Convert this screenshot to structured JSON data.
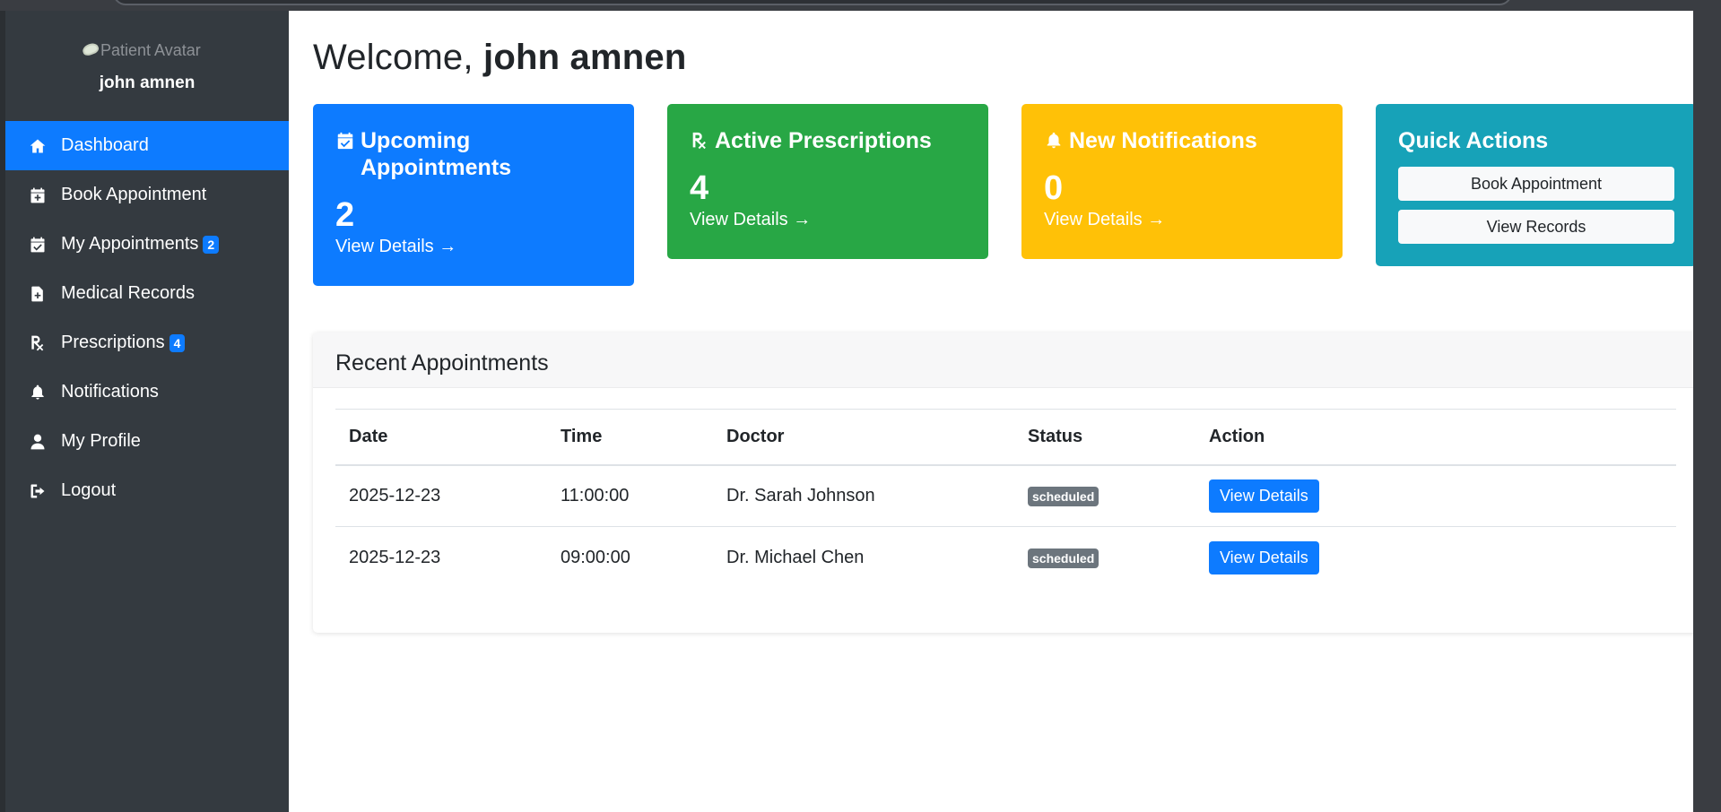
{
  "user": {
    "avatar_alt": "Patient Avatar",
    "name": "john amnen"
  },
  "sidebar": {
    "items": [
      {
        "label": "Dashboard",
        "icon": "home-icon",
        "active": true,
        "badge": ""
      },
      {
        "label": "Book Appointment",
        "icon": "calendar-plus-icon",
        "active": false,
        "badge": ""
      },
      {
        "label": "My Appointments",
        "icon": "calendar-check-icon",
        "active": false,
        "badge": "2"
      },
      {
        "label": "Medical Records",
        "icon": "file-medical-icon",
        "active": false,
        "badge": ""
      },
      {
        "label": "Prescriptions",
        "icon": "prescription-icon",
        "active": false,
        "badge": "4"
      },
      {
        "label": "Notifications",
        "icon": "bell-icon",
        "active": false,
        "badge": ""
      },
      {
        "label": "My Profile",
        "icon": "user-icon",
        "active": false,
        "badge": ""
      },
      {
        "label": "Logout",
        "icon": "sign-out-icon",
        "active": false,
        "badge": ""
      }
    ]
  },
  "main": {
    "welcome_prefix": "Welcome, ",
    "welcome_name": "john amnen",
    "cards": {
      "upcoming": {
        "title": "Upcoming Appointments",
        "value": "2",
        "link": "View Details →",
        "color": "#0d7bff"
      },
      "prescriptions": {
        "title": "Active Prescriptions",
        "value": "4",
        "link": "View Details →",
        "color": "#28a745"
      },
      "notifications": {
        "title": "New Notifications",
        "value": "0",
        "link": "View Details →",
        "color": "#ffc107"
      },
      "quick_actions": {
        "title": "Quick Actions",
        "book_label": "Book Appointment",
        "records_label": "View Records",
        "color": "#17a2b8"
      }
    },
    "recent": {
      "title": "Recent Appointments",
      "columns": [
        "Date",
        "Time",
        "Doctor",
        "Status",
        "Action"
      ],
      "rows": [
        {
          "date": "2025-12-23",
          "time": "11:00:00",
          "doctor": "Dr. Sarah Johnson",
          "status": "scheduled",
          "action": "View Details"
        },
        {
          "date": "2025-12-23",
          "time": "09:00:00",
          "doctor": "Dr. Michael Chen",
          "status": "scheduled",
          "action": "View Details"
        }
      ]
    }
  }
}
